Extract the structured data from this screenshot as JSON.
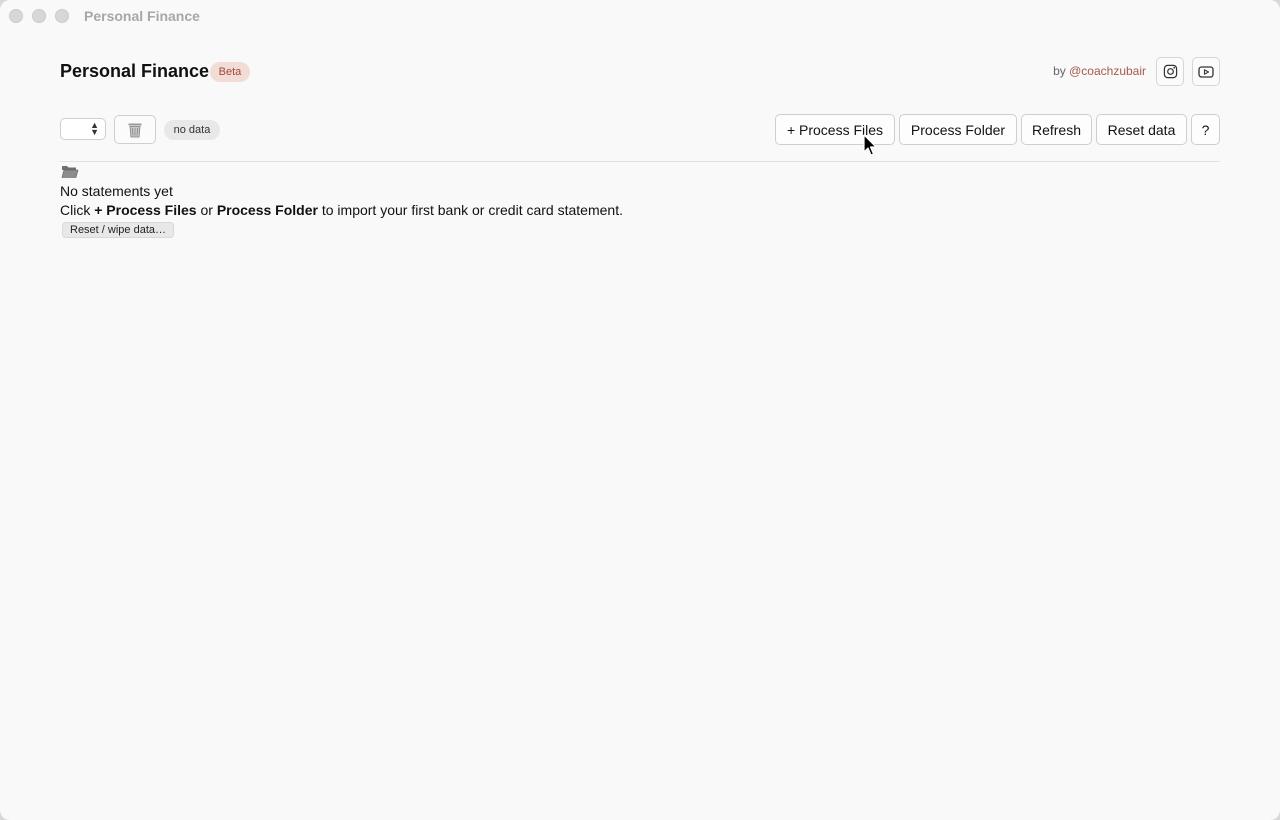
{
  "window": {
    "title": "Personal Finance"
  },
  "header": {
    "title": "Personal Finance",
    "badge": "Beta",
    "by_prefix": "by",
    "author_handle": "@coachzubair",
    "social": [
      "instagram-icon",
      "youtube-icon"
    ]
  },
  "toolbar": {
    "select_value": "",
    "trash_icon": "trash-icon",
    "status": "no data",
    "buttons": {
      "process_files": "+ Process Files",
      "process_folder": "Process Folder",
      "refresh": "Refresh",
      "reset": "Reset data",
      "help": "?"
    }
  },
  "empty_state": {
    "icon": "folder-open-icon",
    "title": "No statements yet",
    "desc_1": "Click ",
    "desc_b1": "+ Process Files",
    "desc_2": " or ",
    "desc_b2": "Process Folder",
    "desc_3": " to import your first bank or credit card statement.",
    "wipe_button": "Reset / wipe data…"
  },
  "colors": {
    "accent_handle": "#a55a4c",
    "badge_bg": "#f2dcd6",
    "badge_text": "#a04a3c"
  }
}
